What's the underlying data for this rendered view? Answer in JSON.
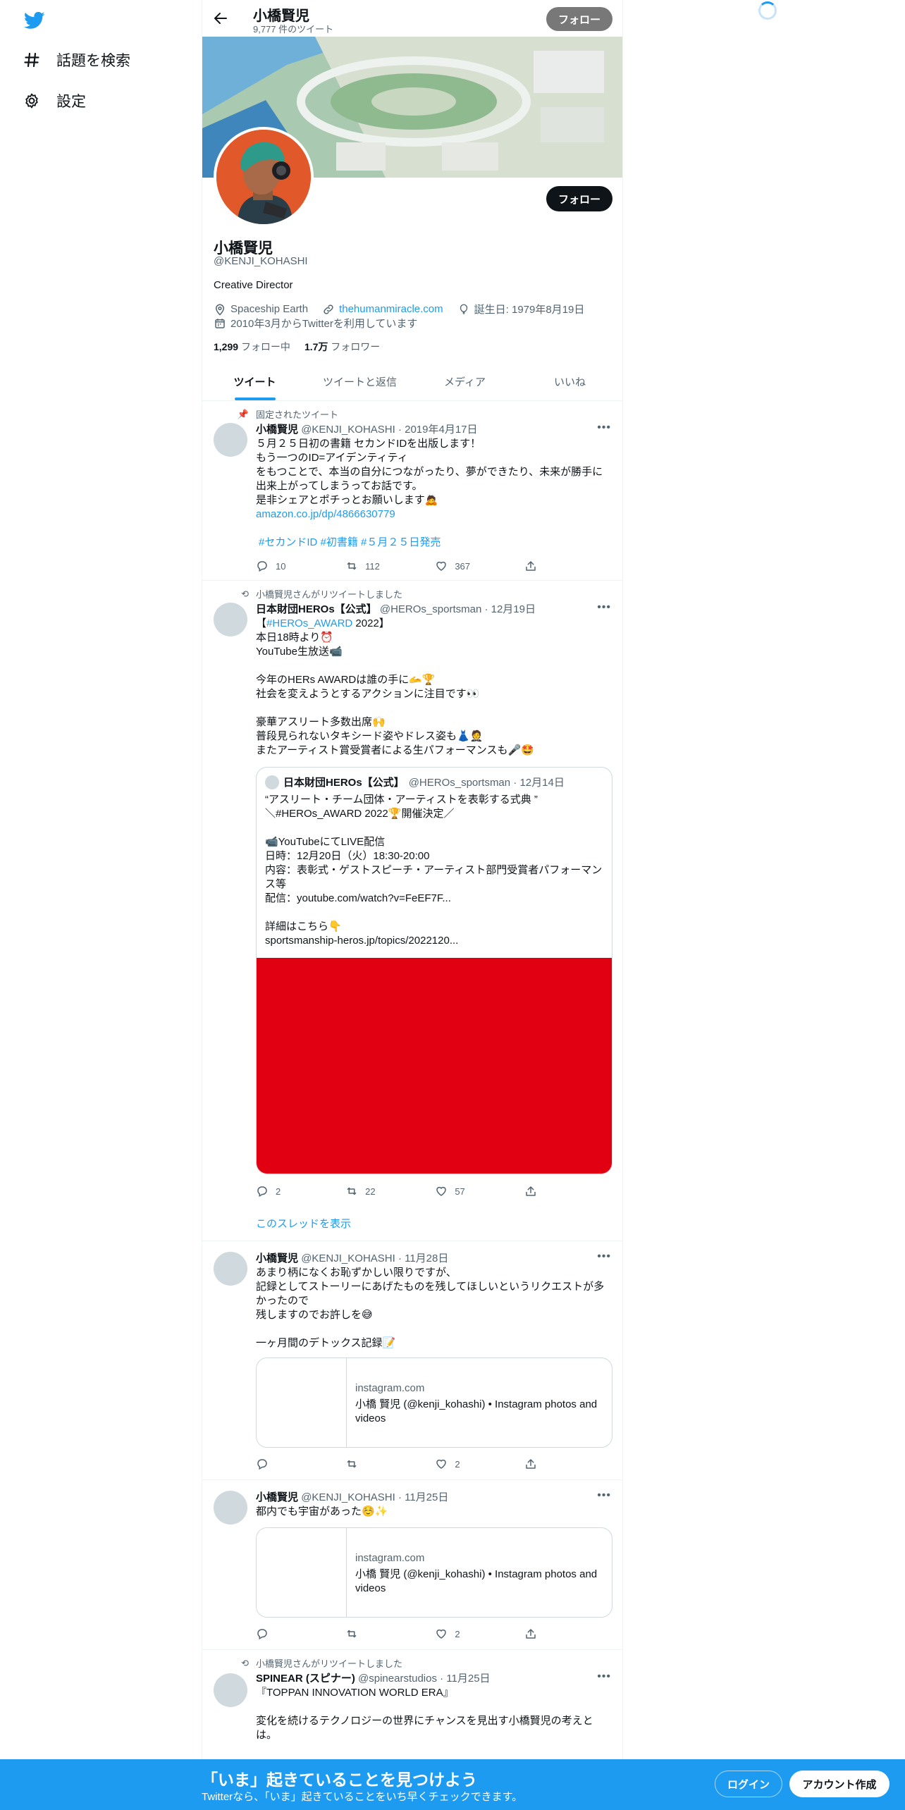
{
  "nav": {
    "items": [
      {
        "label": "話題を検索",
        "icon": "hashtag-icon"
      },
      {
        "label": "設定",
        "icon": "gear-icon"
      }
    ]
  },
  "header": {
    "name": "小橋賢児",
    "tweet_count": "9,777 件のツイート",
    "follow_label": "フォロー"
  },
  "profile": {
    "name": "小橋賢児",
    "handle": "@KENJI_KOHASHI",
    "bio": "Creative Director",
    "location": "Spaceship Earth",
    "url": "thehumanmiracle.com",
    "birthday": "誕生日: 1979年8月19日",
    "joined": "2010年3月からTwitterを利用しています",
    "following_count": "1,299",
    "following_label": "フォロー中",
    "followers_count": "1.7万",
    "followers_label": "フォロワー",
    "follow_button": "フォロー"
  },
  "tabs": [
    "ツイート",
    "ツイートと返信",
    "メディア",
    "いいね"
  ],
  "tweets": [
    {
      "context": "固定されたツイート",
      "name": "小橋賢児",
      "meta": "@KENJI_KOHASHI · 2019年4月17日",
      "text": "５月２５日初の書籍 セカンドIDを出版します！\nもう一つのID=アイデンティティ\nをもつことで、本当の自分につながったり、夢ができたり、未来が勝手に出来上がってしまうってお話です。\n是非シェアとポチっとお願いします🙇",
      "link": "amazon.co.jp/dp/4866630779",
      "hashtags": "#セカンドID #初書籍 #５月２５日発売",
      "reply": "10",
      "retweet": "112",
      "like": "367"
    },
    {
      "context": "小橋賢児さんがリツイートしました",
      "name": "日本財団HEROs【公式】",
      "meta": "@HEROs_sportsman · 12月19日",
      "text_prefix": "【",
      "text_hashtag": "#HEROs_AWARD",
      "text_suffix": " 2022】",
      "text": "本日18時より⏰\nYouTube生放送📹\n\n今年のHERs AWARDは誰の手に🫴🏆\n社会を変えようとするアクションに注目です👀\n\n豪華アスリート多数出席🙌\n普段見られないタキシード姿やドレス姿も👗🤵\nまたアーティスト賞受賞者による生パフォーマンスも🎤🤩",
      "quote": {
        "name": "日本財団HEROs【公式】",
        "meta": "@HEROs_sportsman · 12月14日",
        "text": "“アスリート・チーム団体・アーティストを表彰する式典 ”\n＼#HEROs_AWARD 2022🏆開催決定／\n\n📹YouTubeにてLIVE配信\n日時：12月20日（火）18:30-20:00\n内容：表彰式・ゲストスピーチ・アーティスト部門受賞者パフォーマンス等\n配信：youtube.com/watch?v=FeEF7F...\n\n詳細はこちら👇\nsportsmanship-heros.jp/topics/2022120..."
      },
      "reply": "2",
      "retweet": "22",
      "like": "57",
      "thread_link": "このスレッドを表示"
    },
    {
      "name": "小橋賢児",
      "meta": "@KENJI_KOHASHI · 11月28日",
      "text": "あまり柄になくお恥ずかしい限りですが、\n記録としてストーリーにあげたものを残してほしいというリクエストが多かったので\n残しますのでお許しを😅\n\n一ヶ月間のデトックス記録📝",
      "card": {
        "domain": "instagram.com",
        "title": "小橋 賢児 (@kenji_kohashi) • Instagram photos and videos"
      },
      "reply": "",
      "retweet": "",
      "like": "2"
    },
    {
      "name": "小橋賢児",
      "meta": "@KENJI_KOHASHI · 11月25日",
      "text": "都内でも宇宙があった☺️✨",
      "card": {
        "domain": "instagram.com",
        "title": "小橋 賢児 (@kenji_kohashi) • Instagram photos and videos"
      },
      "reply": "",
      "retweet": "",
      "like": "2"
    },
    {
      "context": "小橋賢児さんがリツイートしました",
      "name": "SPINEAR (スピナー)",
      "meta": "@spinearstudios · 11月25日",
      "text": "『TOPPAN INNOVATION WORLD ERA』\n\n変化を続けるテクノロジーの世界にチャンスを見出す小橋賢児の考えとは。"
    }
  ],
  "bottom": {
    "title": "「いま」起きていることを見つけよう",
    "subtitle": "Twitterなら、「いま」起きていることをいち早くチェックできます。",
    "login": "ログイン",
    "signup": "アカウント作成"
  },
  "colors": {
    "accent": "#1d9bf0",
    "text": "#0f1419",
    "muted": "#536471"
  }
}
